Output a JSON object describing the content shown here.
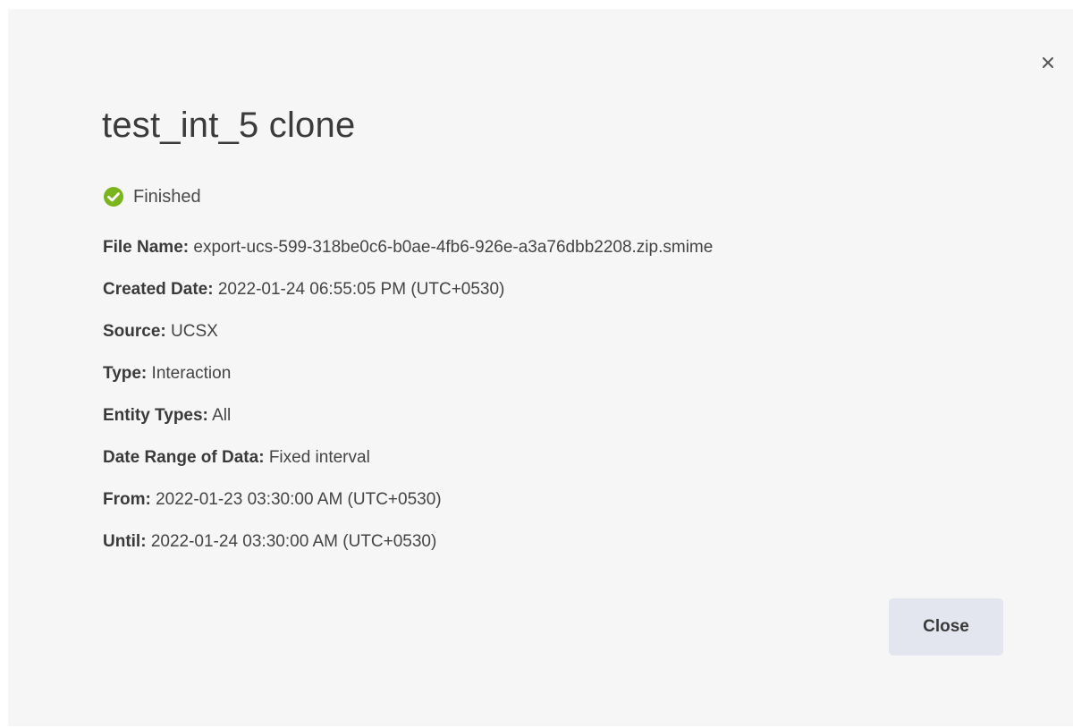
{
  "dialog": {
    "title": "test_int_5 clone",
    "status": {
      "label": "Finished",
      "icon": "check-circle-icon",
      "color": "#7ab51d"
    },
    "close_icon": "close-icon",
    "details": [
      {
        "key": "File Name:",
        "value": "export-ucs-599-318be0c6-b0ae-4fb6-926e-a3a76dbb2208.zip.smime"
      },
      {
        "key": "Created Date:",
        "value": "2022-01-24 06:55:05 PM (UTC+0530)"
      },
      {
        "key": "Source:",
        "value": "UCSX"
      },
      {
        "key": "Type:",
        "value": "Interaction"
      },
      {
        "key": "Entity Types:",
        "value": "All"
      },
      {
        "key": "Date Range of Data:",
        "value": "Fixed interval"
      },
      {
        "key": "From:",
        "value": "2022-01-23 03:30:00 AM (UTC+0530)"
      },
      {
        "key": "Until:",
        "value": "2022-01-24 03:30:00 AM (UTC+0530)"
      }
    ],
    "close_button_label": "Close"
  }
}
